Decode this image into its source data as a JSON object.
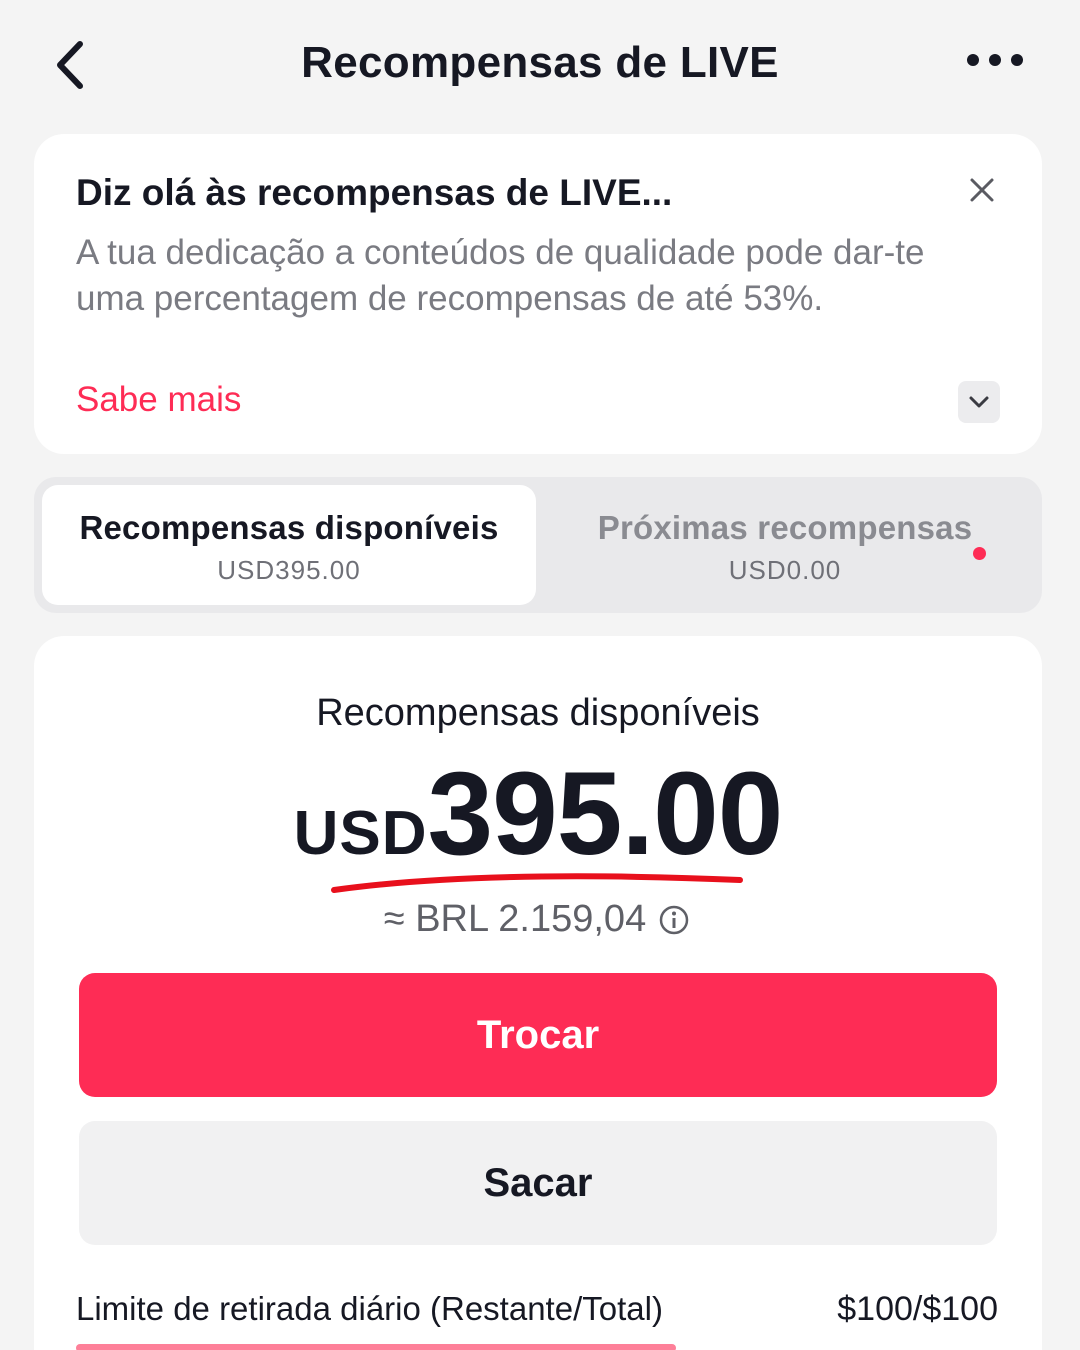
{
  "header": {
    "title": "Recompensas de LIVE",
    "back_icon": "chevron-left-icon",
    "more_icon": "more-horizontal-icon"
  },
  "banner": {
    "title": "Diz olá às recompensas de LIVE...",
    "text": "A tua dedicação a conteúdos de qualidade pode dar-te uma percentagem de recompensas de até 53%.",
    "link": "Sabe mais",
    "close_icon": "close-icon",
    "expand_icon": "chevron-down-icon"
  },
  "tabs": [
    {
      "label": "Recompensas disponíveis",
      "amount": "USD395.00",
      "selected": true
    },
    {
      "label": "Próximas recompensas",
      "amount": "USD0.00",
      "selected": false,
      "has_dot": true
    }
  ],
  "balance": {
    "label": "Recompensas disponíveis",
    "currency": "USD",
    "amount": "395.00",
    "conversion": "≈ BRL 2.159,04"
  },
  "buttons": {
    "primary": "Trocar",
    "secondary": "Sacar"
  },
  "limit": {
    "label": "Limite de retirada diário (Restante/Total)",
    "value": "$100/$100"
  },
  "colors": {
    "accent": "#fe2c55",
    "background": "#f4f4f4",
    "card": "#ffffff",
    "text": "#161823",
    "muted": "#7a7b82"
  }
}
